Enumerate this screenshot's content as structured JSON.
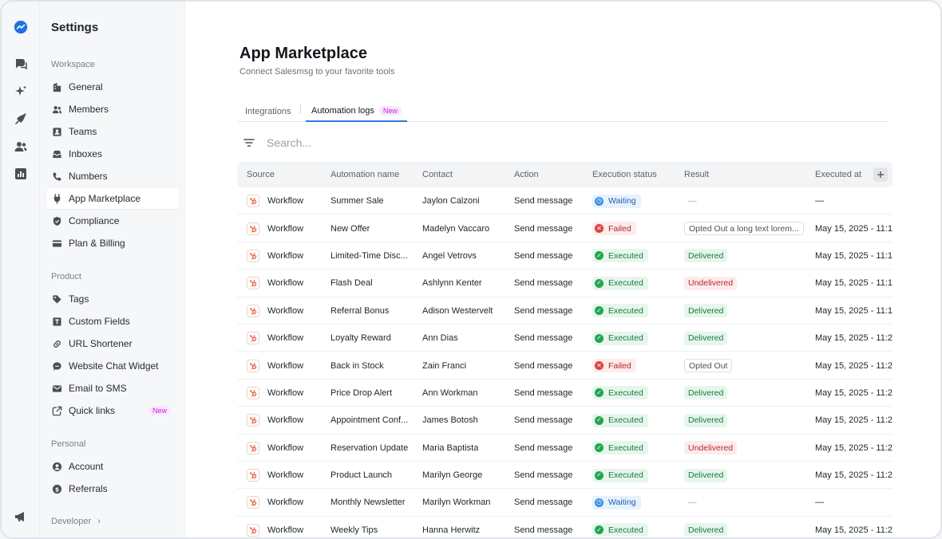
{
  "sidebar": {
    "title": "Settings",
    "sections": [
      {
        "label": "Workspace",
        "items": [
          {
            "label": "General",
            "icon": "building-icon"
          },
          {
            "label": "Members",
            "icon": "members-icon"
          },
          {
            "label": "Teams",
            "icon": "teams-icon"
          },
          {
            "label": "Inboxes",
            "icon": "inbox-icon"
          },
          {
            "label": "Numbers",
            "icon": "phone-icon"
          },
          {
            "label": "App Marketplace",
            "icon": "plug-icon",
            "active": true
          },
          {
            "label": "Compliance",
            "icon": "shield-icon"
          },
          {
            "label": "Plan & Billing",
            "icon": "credit-card-icon"
          }
        ]
      },
      {
        "label": "Product",
        "items": [
          {
            "label": "Tags",
            "icon": "tag-icon"
          },
          {
            "label": "Custom Fields",
            "icon": "text-field-icon"
          },
          {
            "label": "URL Shortener",
            "icon": "link-icon"
          },
          {
            "label": "Website Chat Widget",
            "icon": "chat-bubble-icon"
          },
          {
            "label": "Email to SMS",
            "icon": "mail-icon"
          },
          {
            "label": "Quick links",
            "icon": "external-link-icon",
            "badge": "New"
          }
        ]
      },
      {
        "label": "Personal",
        "items": [
          {
            "label": "Account",
            "icon": "user-circle-icon"
          },
          {
            "label": "Referrals",
            "icon": "dollar-icon"
          }
        ]
      }
    ],
    "developer": "Developer"
  },
  "main": {
    "title": "App Marketplace",
    "subtitle": "Connect Salesmsg to your favorite tools",
    "tabs": [
      {
        "label": "Integrations"
      },
      {
        "label": "Automation logs",
        "badge": "New",
        "active": true
      }
    ],
    "search_placeholder": "Search..."
  },
  "table": {
    "columns": [
      "Source",
      "Automation name",
      "Contact",
      "Action",
      "Execution status",
      "Result",
      "Executed at"
    ],
    "rows": [
      {
        "source": "Workflow",
        "name": "Summer Sale",
        "contact": "Jaylon Calzoni",
        "action": "Send message",
        "status": "Waiting",
        "result": "—",
        "executed": "—"
      },
      {
        "source": "Workflow",
        "name": "New Offer",
        "contact": "Madelyn Vaccaro",
        "action": "Send message",
        "status": "Failed",
        "result": "Opted Out a long text lorem...",
        "executed": "May 15, 2025 - 11:1"
      },
      {
        "source": "Workflow",
        "name": "Limited-Time Disc...",
        "contact": "Angel Vetrovs",
        "action": "Send message",
        "status": "Executed",
        "result": "Delivered",
        "executed": "May 15, 2025 - 11:1"
      },
      {
        "source": "Workflow",
        "name": "Flash Deal",
        "contact": "Ashlynn Kenter",
        "action": "Send message",
        "status": "Executed",
        "result": "Undelivered",
        "executed": "May 15, 2025 - 11:1"
      },
      {
        "source": "Workflow",
        "name": "Referral Bonus",
        "contact": "Adison Westervelt",
        "action": "Send message",
        "status": "Executed",
        "result": "Delivered",
        "executed": "May 15, 2025 - 11:1"
      },
      {
        "source": "Workflow",
        "name": "Loyalty Reward",
        "contact": "Ann Dias",
        "action": "Send message",
        "status": "Executed",
        "result": "Delivered",
        "executed": "May 15, 2025 - 11:2"
      },
      {
        "source": "Workflow",
        "name": "Back in Stock",
        "contact": "Zain Franci",
        "action": "Send message",
        "status": "Failed",
        "result": "Opted Out",
        "executed": "May 15, 2025 - 11:2"
      },
      {
        "source": "Workflow",
        "name": "Price Drop Alert",
        "contact": "Ann Workman",
        "action": "Send message",
        "status": "Executed",
        "result": "Delivered",
        "executed": "May 15, 2025 - 11:2"
      },
      {
        "source": "Workflow",
        "name": "Appointment Conf...",
        "contact": "James Botosh",
        "action": "Send message",
        "status": "Executed",
        "result": "Delivered",
        "executed": "May 15, 2025 - 11:2"
      },
      {
        "source": "Workflow",
        "name": "Reservation Update",
        "contact": "Maria Baptista",
        "action": "Send message",
        "status": "Executed",
        "result": "Undelivered",
        "executed": "May 15, 2025 - 11:2"
      },
      {
        "source": "Workflow",
        "name": "Product Launch",
        "contact": "Marilyn George",
        "action": "Send message",
        "status": "Executed",
        "result": "Delivered",
        "executed": "May 15, 2025 - 11:2"
      },
      {
        "source": "Workflow",
        "name": "Monthly Newsletter",
        "contact": "Marilyn Workman",
        "action": "Send message",
        "status": "Waiting",
        "result": "—",
        "executed": "—"
      },
      {
        "source": "Workflow",
        "name": "Weekly Tips",
        "contact": "Hanna Herwitz",
        "action": "Send message",
        "status": "Executed",
        "result": "Delivered",
        "executed": "May 15, 2025 - 11:2"
      }
    ]
  },
  "colors": {
    "accent": "#2b78e4",
    "hubspot": "#ff5c35",
    "executed": "#22a652",
    "failed": "#e53e3e",
    "waiting": "#3b8ee6",
    "new_badge": "#c026d3"
  }
}
